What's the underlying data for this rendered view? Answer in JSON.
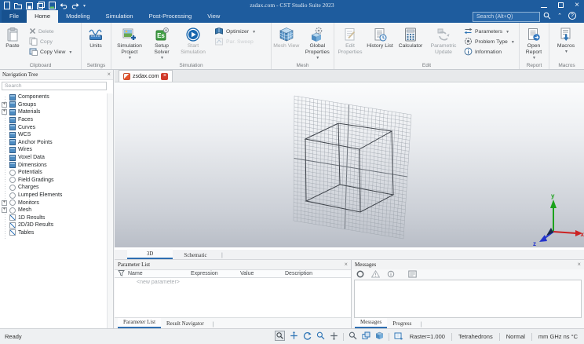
{
  "window": {
    "title": "zsdax.com - CST Studio Suite 2023",
    "search_placeholder": "Search (Alt+Q)",
    "qat_icons": [
      "new-file",
      "open",
      "save",
      "save-all",
      "import",
      "undo",
      "redo",
      "customize"
    ],
    "controls": [
      "minimize",
      "maximize",
      "close"
    ]
  },
  "ribbon": {
    "tabs": [
      {
        "label": "File",
        "active": false
      },
      {
        "label": "Home",
        "active": true
      },
      {
        "label": "Modeling",
        "active": false
      },
      {
        "label": "Simulation",
        "active": false
      },
      {
        "label": "Post-Processing",
        "active": false
      },
      {
        "label": "View",
        "active": false
      }
    ],
    "groups": [
      {
        "label": "Clipboard",
        "large": [
          {
            "label": "Paste"
          }
        ],
        "small": [
          {
            "label": "Delete",
            "disabled": true
          },
          {
            "label": "Copy",
            "disabled": true
          },
          {
            "label": "Copy View",
            "dropdown": true
          }
        ]
      },
      {
        "label": "Settings",
        "large": [
          {
            "label": "Units"
          }
        ]
      },
      {
        "label": "Simulation",
        "large": [
          {
            "label": "Simulation Project",
            "dropdown": true
          },
          {
            "label": "Setup Solver",
            "dropdown": true
          },
          {
            "label": "Start Simulation"
          }
        ],
        "small": [
          {
            "label": "Optimizer",
            "dropdown": true
          },
          {
            "label": "Par. Sweep",
            "disabled": true
          }
        ]
      },
      {
        "label": "Mesh",
        "large": [
          {
            "label": "Mesh View"
          },
          {
            "label": "Global Properties",
            "dropdown": true
          }
        ]
      },
      {
        "label": "Edit",
        "large": [
          {
            "label": "Edit Properties",
            "disabled": true
          },
          {
            "label": "History List"
          },
          {
            "label": "Calculator"
          },
          {
            "label": "Parametric Update",
            "disabled": true
          }
        ],
        "small": [
          {
            "label": "Parameters",
            "dropdown": true
          },
          {
            "label": "Problem Type",
            "dropdown": true
          },
          {
            "label": "Information"
          }
        ]
      },
      {
        "label": "Report",
        "large": [
          {
            "label": "Open Report",
            "dropdown": true
          }
        ]
      },
      {
        "label": "Macros",
        "large": [
          {
            "label": "Macros",
            "dropdown": true
          }
        ]
      }
    ]
  },
  "navigation_tree": {
    "title": "Navigation Tree",
    "search_placeholder": "Search",
    "items": [
      {
        "label": "Components",
        "icon": "cube",
        "expand": false
      },
      {
        "label": "Groups",
        "icon": "cube",
        "expand": true
      },
      {
        "label": "Materials",
        "icon": "cube",
        "expand": true
      },
      {
        "label": "Faces",
        "icon": "cube",
        "expand": false
      },
      {
        "label": "Curves",
        "icon": "cube",
        "expand": false
      },
      {
        "label": "WCS",
        "icon": "cube",
        "expand": false
      },
      {
        "label": "Anchor Points",
        "icon": "cube",
        "expand": false
      },
      {
        "label": "Wires",
        "icon": "cube",
        "expand": false
      },
      {
        "label": "Voxel Data",
        "icon": "cube",
        "expand": false
      },
      {
        "label": "Dimensions",
        "icon": "cube",
        "expand": false
      },
      {
        "label": "Potentials",
        "icon": "circle",
        "expand": false
      },
      {
        "label": "Field Gradings",
        "icon": "circle",
        "expand": false
      },
      {
        "label": "Charges",
        "icon": "circle",
        "expand": false
      },
      {
        "label": "Lumped Elements",
        "icon": "circle",
        "expand": false
      },
      {
        "label": "Monitors",
        "icon": "circle",
        "expand": true
      },
      {
        "label": "Mesh",
        "icon": "circle",
        "expand": true
      },
      {
        "label": "1D Results",
        "icon": "chart",
        "expand": false
      },
      {
        "label": "2D/3D Results",
        "icon": "chart",
        "expand": false
      },
      {
        "label": "Tables",
        "icon": "chart",
        "expand": false
      }
    ]
  },
  "document": {
    "tab_label": "zsdax.com",
    "view_tabs": [
      {
        "label": "3D",
        "active": true
      },
      {
        "label": "Schematic",
        "active": false
      }
    ],
    "axes": {
      "x": "x",
      "y": "y",
      "z": "z"
    },
    "axis_colors": {
      "x": "#cc2222",
      "y": "#1ca21c",
      "z": "#2233cc"
    }
  },
  "parameter_list": {
    "title": "Parameter List",
    "columns": [
      "Name",
      "Expression",
      "Value",
      "Description"
    ],
    "new_row": "<new parameter>",
    "tabs": [
      {
        "label": "Parameter List",
        "active": true
      },
      {
        "label": "Result Navigator",
        "active": false
      }
    ]
  },
  "messages": {
    "title": "Messages",
    "toolbar_icons": [
      "errors",
      "warnings",
      "information",
      "log"
    ],
    "tabs": [
      {
        "label": "Messages",
        "active": true
      },
      {
        "label": "Progress",
        "active": false
      }
    ]
  },
  "status_bar": {
    "ready": "Ready",
    "icons": [
      "zoom-window",
      "move",
      "rotate",
      "zoom",
      "pan",
      "magnifier",
      "layers",
      "mesh-cells",
      "raster"
    ],
    "items": [
      "Raster=1.000",
      "Tetrahedrons",
      "Normal",
      "mm GHz ns °C"
    ]
  },
  "accent_colors": {
    "titlebar": "#1e5c9e",
    "active_tab_underline": "#2f6fb2",
    "close_red": "#d03a2a"
  }
}
